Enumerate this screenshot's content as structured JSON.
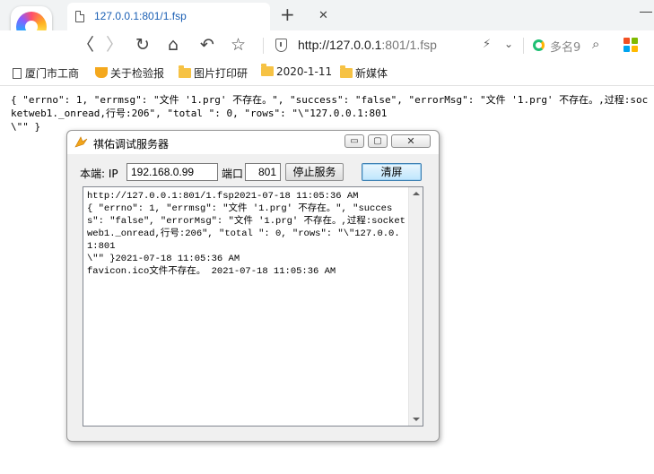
{
  "browser": {
    "tab_title": "127.0.0.1:801/1.fsp",
    "tab_close": "✕",
    "new_tab": "+",
    "address_host": "http://127.0.0.1",
    "address_rest": ":801/1.fsp",
    "search_placeholder": "多名9",
    "nav": {
      "back": "〈",
      "forward": "〉",
      "reload": "↻",
      "home": "⌂",
      "undo": "↶",
      "star": "☆"
    },
    "bookmarks": [
      "厦门市工商",
      "关于检验报",
      "图片打印研",
      "2020-1-11",
      "新媒体"
    ]
  },
  "page": {
    "json_text": "{ \"errno\": 1, \"errmsg\": \"文件 '1.prg' 不存在。\", \"success\": \"false\", \"errorMsg\": \"文件 '1.prg' 不存在。,过程:socketweb1._onread,行号:206\", \"total \": 0, \"rows\": \"\\\"127.0.0.1:801\n\\\"\" }"
  },
  "dialog": {
    "title": "祺佑调试服务器",
    "min_label": "▭",
    "max_label": "▢",
    "close_label": "✕",
    "local_label": "本端: IP",
    "ip_value": "192.168.0.99",
    "port_label": "端口",
    "port_value": "801",
    "stop_button": "停止服务",
    "clear_button": "清屏",
    "log_text": "http://127.0.0.1:801/1.fsp2021-07-18 11:05:36 AM\n{ \"errno\": 1, \"errmsg\": \"文件 '1.prg' 不存在。\", \"success\": \"false\", \"errorMsg\": \"文件 '1.prg' 不存在。,过程:socketweb1._onread,行号:206\", \"total \": 0, \"rows\": \"\\\"127.0.0.1:801\n\\\"\" }2021-07-18 11:05:36 AM\nfavicon.ico文件不存在。 2021-07-18 11:05:36 AM"
  },
  "icons": {
    "apps_colors": [
      "#f25022",
      "#7fba00",
      "#00a4ef",
      "#ffb900"
    ]
  }
}
